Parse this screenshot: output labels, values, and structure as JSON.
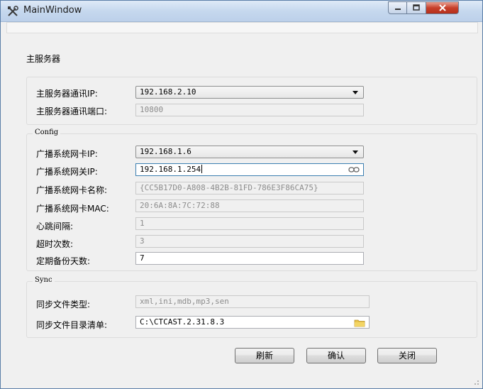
{
  "window": {
    "title": "MainWindow",
    "app_icon": "tools-icon"
  },
  "main_server": {
    "section_title": "主服务器",
    "ip_label": "主服务器通讯IP:",
    "ip_value": "192.168.2.10",
    "port_label": "主服务器通讯端口:",
    "port_value": "10800"
  },
  "config": {
    "legend": "Config",
    "nic_ip_label": "广播系统网卡IP:",
    "nic_ip_value": "192.168.1.6",
    "gateway_label": "广播系统网关IP:",
    "gateway_value": "192.168.1.254",
    "nic_name_label": "广播系统网卡名称:",
    "nic_name_value": "{CC5B17D0-A808-4B2B-81FD-786E3F86CA75}",
    "nic_mac_label": "广播系统网卡MAC:",
    "nic_mac_value": "20:6A:8A:7C:72:88",
    "heartbeat_label": "心跳间隔:",
    "heartbeat_value": "1",
    "timeout_label": "超时次数:",
    "timeout_value": "3",
    "backup_label": "定期备份天数:",
    "backup_value": "7"
  },
  "sync": {
    "legend": "Sync",
    "filetype_label": "同步文件类型:",
    "filetype_value": "xml,ini,mdb,mp3,sen",
    "dir_label": "同步文件目录清单:",
    "dir_value": "C:\\CTCAST.2.31.8.3"
  },
  "buttons": {
    "refresh": "刷新",
    "confirm": "确认",
    "close": "关闭"
  }
}
